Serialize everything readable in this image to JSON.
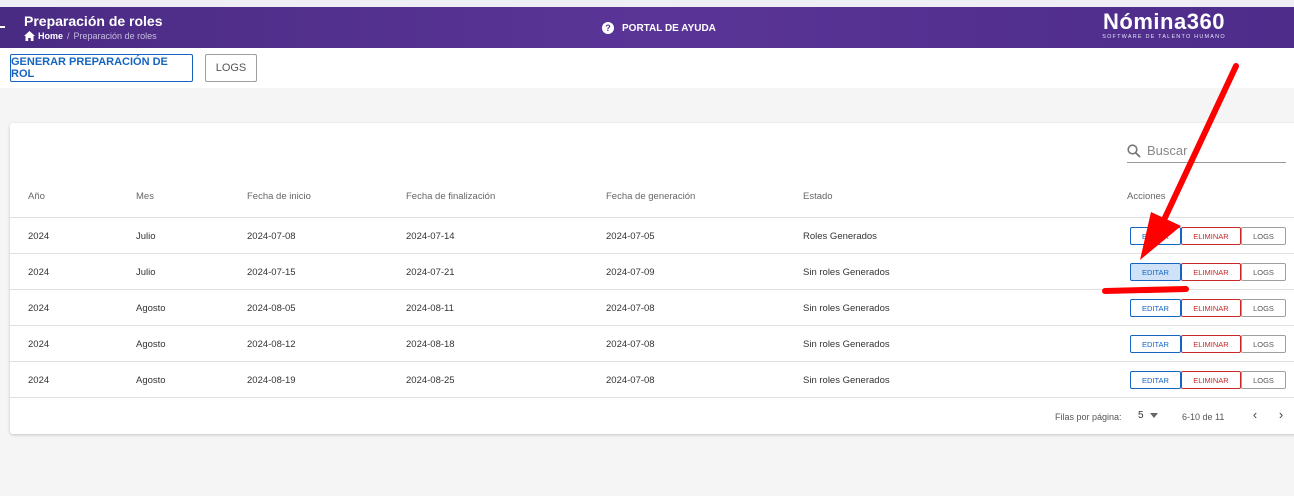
{
  "header": {
    "title": "Preparación de roles",
    "breadcrumb_home": "Home",
    "breadcrumb_sep": "/",
    "breadcrumb_current": "Preparación de roles",
    "help_label": "PORTAL DE AYUDA",
    "brand_name": "Nómina360",
    "brand_tagline": "SOFTWARE DE TALENTO HUMANO"
  },
  "toolbar": {
    "generate_label": "GENERAR PREPARACIÓN DE ROL",
    "logs_label": "LOGS"
  },
  "search": {
    "placeholder": "Buscar"
  },
  "table": {
    "columns": [
      "Año",
      "Mes",
      "Fecha de inicio",
      "Fecha de finalización",
      "Fecha de generación",
      "Estado",
      "Acciones"
    ],
    "rows": [
      {
        "anio": "2024",
        "mes": "Julio",
        "inicio": "2024-07-08",
        "fin": "2024-07-14",
        "generacion": "2024-07-05",
        "estado": "Roles Generados"
      },
      {
        "anio": "2024",
        "mes": "Julio",
        "inicio": "2024-07-15",
        "fin": "2024-07-21",
        "generacion": "2024-07-09",
        "estado": "Sin roles Generados"
      },
      {
        "anio": "2024",
        "mes": "Agosto",
        "inicio": "2024-08-05",
        "fin": "2024-08-11",
        "generacion": "2024-07-08",
        "estado": "Sin roles Generados"
      },
      {
        "anio": "2024",
        "mes": "Agosto",
        "inicio": "2024-08-12",
        "fin": "2024-08-18",
        "generacion": "2024-07-08",
        "estado": "Sin roles Generados"
      },
      {
        "anio": "2024",
        "mes": "Agosto",
        "inicio": "2024-08-19",
        "fin": "2024-08-25",
        "generacion": "2024-07-08",
        "estado": "Sin roles Generados"
      }
    ],
    "actions": {
      "edit": "EDITAR",
      "delete": "ELIMINAR",
      "logs": "LOGS"
    }
  },
  "pagination": {
    "rows_per_page_label": "Filas por página:",
    "rows_per_page_value": "5",
    "range_label": "6-10 de 11",
    "prev_icon": "chevron-left-icon",
    "next_icon": "chevron-right-icon"
  },
  "colors": {
    "header_bg": "#5a3597",
    "primary": "#1565c0",
    "danger": "#c62828",
    "annotation": "#ff0000",
    "highlight_bg": "#cfe2f8"
  }
}
